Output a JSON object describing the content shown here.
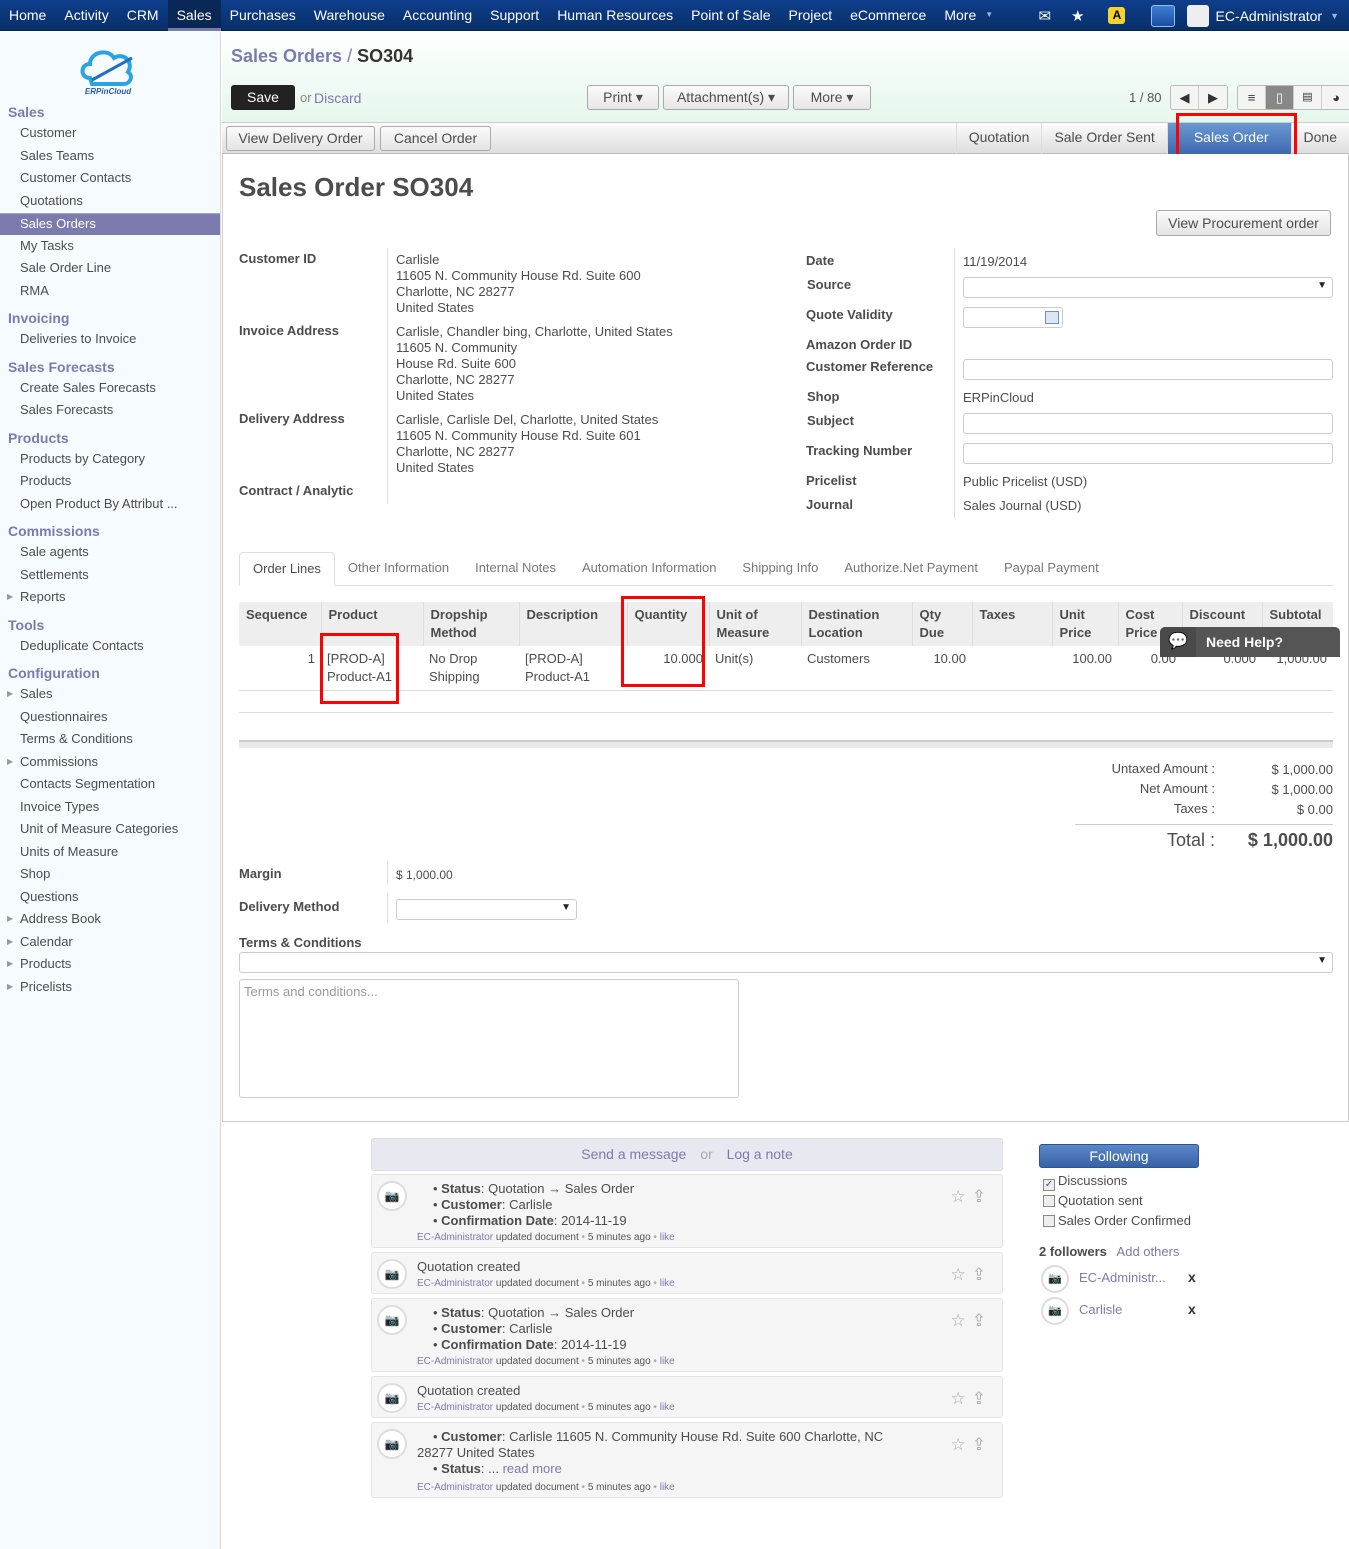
{
  "topnav": {
    "items": [
      "Home",
      "Activity",
      "CRM",
      "Sales",
      "Purchases",
      "Warehouse",
      "Accounting",
      "Support",
      "Human Resources",
      "Point of Sale",
      "Project",
      "eCommerce",
      "More"
    ],
    "active": "Sales",
    "more_caret": "▼",
    "icons": {
      "mail": "✉",
      "star": "★",
      "warning": "A"
    },
    "user": "EC-Administrator"
  },
  "sidebar": {
    "logo_text": "ERPinCloud",
    "sections": [
      {
        "title": "Sales",
        "items": [
          {
            "label": "Customer"
          },
          {
            "label": "Sales Teams"
          },
          {
            "label": "Customer Contacts"
          },
          {
            "label": "Quotations"
          },
          {
            "label": "Sales Orders",
            "active": true
          },
          {
            "label": "My Tasks"
          },
          {
            "label": "Sale Order Line"
          },
          {
            "label": "RMA"
          }
        ]
      },
      {
        "title": "Invoicing",
        "items": [
          {
            "label": "Deliveries to Invoice"
          }
        ]
      },
      {
        "title": "Sales Forecasts",
        "items": [
          {
            "label": "Create Sales Forecasts"
          },
          {
            "label": "Sales Forecasts"
          }
        ]
      },
      {
        "title": "Products",
        "items": [
          {
            "label": "Products by Category"
          },
          {
            "label": "Products"
          },
          {
            "label": "Open Product By Attribut ..."
          }
        ]
      },
      {
        "title": "Commissions",
        "items": [
          {
            "label": "Sale agents"
          },
          {
            "label": "Settlements"
          },
          {
            "label": "Reports",
            "expandable": true
          }
        ]
      },
      {
        "title": "Tools",
        "items": [
          {
            "label": "Deduplicate Contacts"
          }
        ]
      },
      {
        "title": "Configuration",
        "items": [
          {
            "label": "Sales",
            "expandable": true
          },
          {
            "label": "Questionnaires"
          },
          {
            "label": "Terms & Conditions"
          },
          {
            "label": "Commissions",
            "expandable": true
          },
          {
            "label": "Contacts Segmentation"
          },
          {
            "label": "Invoice Types"
          },
          {
            "label": "Unit of Measure Categories"
          },
          {
            "label": "Units of Measure"
          },
          {
            "label": "Shop"
          },
          {
            "label": "Questions"
          },
          {
            "label": "Address Book",
            "expandable": true
          },
          {
            "label": "Calendar",
            "expandable": true
          },
          {
            "label": "Products",
            "expandable": true
          },
          {
            "label": "Pricelists",
            "expandable": true
          }
        ]
      }
    ]
  },
  "header": {
    "breadcrumb_parent": "Sales Orders",
    "breadcrumb_sep": "/",
    "breadcrumb_current": "SO304",
    "save": "Save",
    "or": "or",
    "discard": "Discard",
    "print": "Print ▾",
    "attachments": "Attachment(s) ▾",
    "more": "More ▾",
    "pager": "1 / 80",
    "prev": "◀",
    "next": "▶",
    "views": {
      "list": "≡",
      "form": "▯",
      "calendar": "📅",
      "graph": "◕"
    }
  },
  "statusbar": {
    "view_delivery": "View Delivery Order",
    "cancel_order": "Cancel Order",
    "stages": [
      "Quotation",
      "Sale Order Sent",
      "Sales Order",
      "Done"
    ],
    "current_stage": "Sales Order"
  },
  "form": {
    "title_prefix": "Sales Order",
    "title_number": "SO304",
    "view_procurement": "View Procurement order",
    "left": {
      "customer_id_label": "Customer ID",
      "customer_name": "Carlisle",
      "customer_addr": [
        "11605 N. Community House Rd. Suite 600",
        "Charlotte, NC 28277",
        "United States"
      ],
      "invoice_label": "Invoice Address",
      "invoice_name": "Carlisle, Chandler bing, Charlotte, United States",
      "invoice_addr": [
        "11605 N. Community",
        "House Rd. Suite 600",
        "Charlotte, NC 28277",
        "United States"
      ],
      "delivery_label": "Delivery Address",
      "delivery_name": "Carlisle, Carlisle Del, Charlotte, United States",
      "delivery_addr": [
        "11605 N. Community House Rd. Suite 601",
        "Charlotte, NC 28277",
        "United States"
      ],
      "contract_label": "Contract / Analytic"
    },
    "right": {
      "date_label": "Date",
      "date": "11/19/2014",
      "source_label": "Source",
      "source": "",
      "quote_validity_label": "Quote Validity",
      "quote_validity": "",
      "amazon_label": "Amazon Order ID",
      "customer_ref_label": "Customer Reference",
      "customer_ref": "",
      "shop_label": "Shop",
      "shop": "ERPinCloud",
      "subject_label": "Subject",
      "subject": "",
      "tracking_label": "Tracking Number",
      "tracking": "",
      "pricelist_label": "Pricelist",
      "pricelist": "Public Pricelist (USD)",
      "journal_label": "Journal",
      "journal": "Sales Journal (USD)"
    },
    "tabs": [
      "Order Lines",
      "Other Information",
      "Internal Notes",
      "Automation Information",
      "Shipping Info",
      "Authorize.Net Payment",
      "Paypal Payment"
    ],
    "active_tab": "Order Lines",
    "order_lines": {
      "columns": [
        "Sequence",
        "Product",
        "Dropship Method",
        "Description",
        "Quantity",
        "Unit of Measure",
        "Destination Location",
        "Qty Due",
        "Taxes",
        "Unit Price",
        "Cost Price",
        "Discount (%)",
        "Subtotal"
      ],
      "rows": [
        {
          "sequence": "1",
          "product": "[PROD-A] Product-A1",
          "dropship": "No Drop Shipping",
          "description": "[PROD-A] Product-A1",
          "quantity": "10.000",
          "uom": "Unit(s)",
          "destination": "Customers",
          "qty_due": "10.00",
          "taxes": "",
          "unit_price": "100.00",
          "cost_price": "0.00",
          "discount": "0.000",
          "subtotal": "1,000.00"
        }
      ]
    },
    "need_help": "Need Help?",
    "totals": {
      "untaxed_label": "Untaxed Amount :",
      "untaxed": "$ 1,000.00",
      "net_label": "Net Amount :",
      "net": "$ 1,000.00",
      "taxes_label": "Taxes :",
      "taxes": "$ 0.00",
      "total_label": "Total :",
      "total": "$ 1,000.00"
    },
    "margin_label": "Margin",
    "margin": "$ 1,000.00",
    "delivery_method_label": "Delivery Method",
    "delivery_method": "",
    "terms_label": "Terms & Conditions",
    "terms_placeholder": "Terms and conditions..."
  },
  "chatter": {
    "send_message": "Send a message",
    "or": "or",
    "log_note": "Log a note",
    "messages": [
      {
        "lines": [
          {
            "k": "Status",
            "v": ": Quotation → Sales Order"
          },
          {
            "k": "Customer",
            "v": ": Carlisle"
          },
          {
            "k": "Confirmation Date",
            "v": ": 2014-11-19"
          }
        ],
        "author": "EC-Administrator",
        "action": "updated document",
        "time": "5 minutes ago",
        "like": "like"
      },
      {
        "text": "Quotation created",
        "author": "EC-Administrator",
        "action": "updated document",
        "time": "5 minutes ago",
        "like": "like"
      },
      {
        "lines": [
          {
            "k": "Status",
            "v": ": Quotation → Sales Order"
          },
          {
            "k": "Customer",
            "v": ": Carlisle"
          },
          {
            "k": "Confirmation Date",
            "v": ": 2014-11-19"
          }
        ],
        "author": "EC-Administrator",
        "action": "updated document",
        "time": "5 minutes ago",
        "like": "like"
      },
      {
        "text": "Quotation created",
        "author": "EC-Administrator",
        "action": "updated document",
        "time": "5 minutes ago",
        "like": "like"
      },
      {
        "lines": [
          {
            "k": "Customer",
            "v": ": Carlisle 11605 N. Community House Rd. Suite 600 Charlotte, NC 28277 United States"
          },
          {
            "k": "Status",
            "v": ": ...",
            "more": "read more"
          }
        ],
        "author": "EC-Administrator",
        "action": "updated document",
        "time": "5 minutes ago",
        "like": "like"
      }
    ],
    "following": "Following",
    "subscriptions": [
      {
        "label": "Discussions",
        "checked": true
      },
      {
        "label": "Quotation sent",
        "checked": false
      },
      {
        "label": "Sales Order Confirmed",
        "checked": false
      }
    ],
    "followers_count": "2 followers",
    "add_others": "Add others",
    "followers": [
      {
        "name": "EC-Administr..."
      },
      {
        "name": "Carlisle"
      }
    ],
    "remove": "x"
  }
}
